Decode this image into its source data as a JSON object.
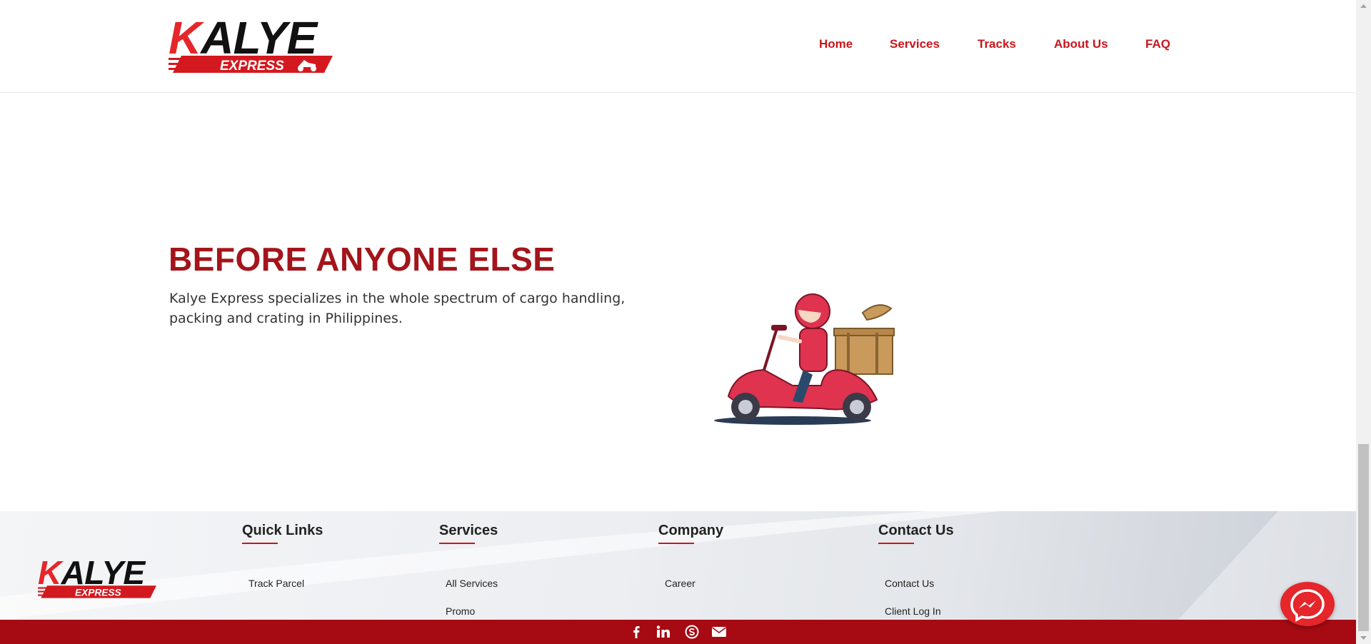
{
  "brand": {
    "name": "KALYE",
    "sub": "EXPRESS",
    "primary_color": "#c8161d",
    "dark_red": "#a60a13"
  },
  "nav": {
    "items": [
      "Home",
      "Services",
      "Tracks",
      "About Us",
      "FAQ"
    ]
  },
  "hero": {
    "title": "BEFORE ANYONE ELSE",
    "text": "Kalye Express specializes in the whole spectrum of cargo handling, packing and crating in Philippines.",
    "image_icon": "delivery-scooter-illustration"
  },
  "footer": {
    "columns": [
      {
        "heading": "Quick Links",
        "links": [
          "Track Parcel"
        ]
      },
      {
        "heading": "Services",
        "links": [
          "All Services",
          "Promo"
        ]
      },
      {
        "heading": "Company",
        "links": [
          "Career"
        ]
      },
      {
        "heading": "Contact Us",
        "links": [
          "Contact Us",
          "Client Log In"
        ]
      }
    ],
    "social_icons": [
      "facebook-icon",
      "linkedin-icon",
      "skype-icon",
      "envelope-icon"
    ]
  },
  "widgets": {
    "chat_icon": "messenger-icon"
  }
}
